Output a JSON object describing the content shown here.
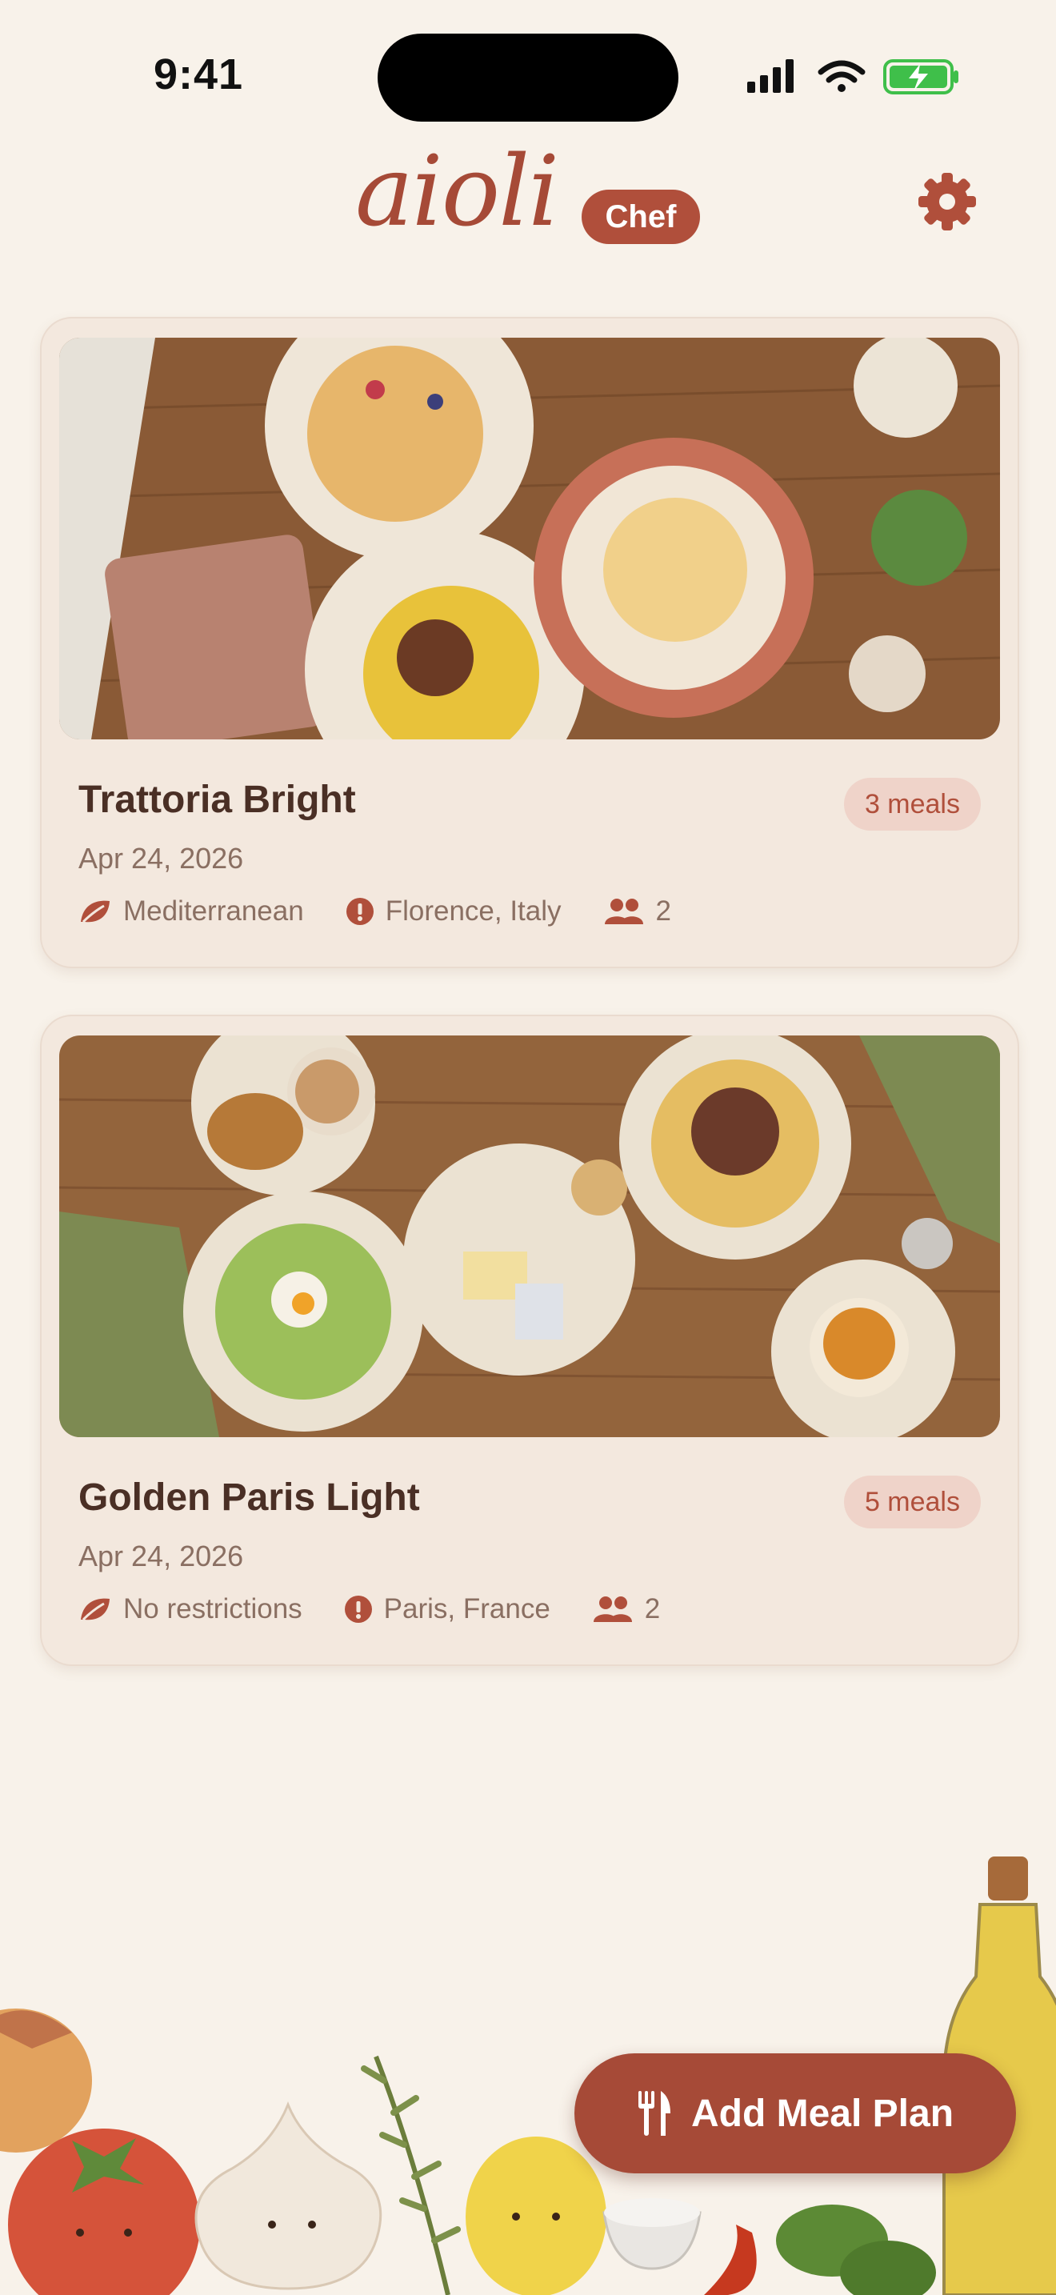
{
  "status_bar": {
    "time": "9:41"
  },
  "header": {
    "logo_text": "aioli",
    "badge": "Chef"
  },
  "plans": [
    {
      "title": "Trattoria Bright",
      "meals": "3 meals",
      "date": "Apr 24, 2026",
      "diet": "Mediterranean",
      "location": "Florence, Italy",
      "people": "2"
    },
    {
      "title": "Golden Paris Light",
      "meals": "5 meals",
      "date": "Apr 24, 2026",
      "diet": "No restrictions",
      "location": "Paris, France",
      "people": "2"
    }
  ],
  "fab": {
    "label": "Add Meal Plan"
  },
  "colors": {
    "accent": "#a64a37",
    "background": "#f8f2ea",
    "card": "#f3e8de",
    "pill": "#efd3c9",
    "battery": "#3fbf4a"
  }
}
